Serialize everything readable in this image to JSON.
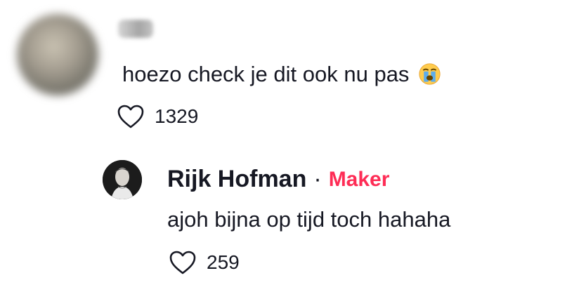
{
  "comment": {
    "text": "hoezo check je dit ook nu pas",
    "emoji": "loudly-crying-face-emoji",
    "likes": "1329"
  },
  "reply": {
    "author": "Rijk Hofman",
    "separator": "·",
    "badge": "Maker",
    "text": "ajoh bijna op tijd toch hahaha",
    "likes": "259"
  },
  "colors": {
    "text": "#161823",
    "creator_badge": "#fe2c55",
    "icon_stroke": "#161823"
  },
  "icons": {
    "like": "heart-outline-icon"
  }
}
